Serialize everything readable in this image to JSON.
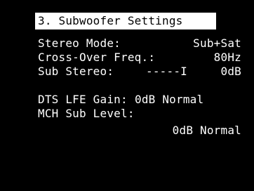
{
  "screen": {
    "title": "3. Subwoofer Settings",
    "rows": [
      {
        "label": "Stereo Mode:",
        "value": "Sub+Sat"
      },
      {
        "label": "Cross-Over Freq.:",
        "value": "80Hz"
      },
      {
        "label": "Sub Stereo:",
        "slider": "-----I",
        "value": "0dB"
      },
      {
        "label": "DTS LFE Gain:",
        "value": "0dB Normal"
      },
      {
        "label": "MCH Sub Level:"
      },
      {
        "value": "0dB Normal"
      }
    ]
  },
  "colors": {
    "background": "#000000",
    "text": "#ffffff",
    "title_bg": "#ffffff",
    "title_text": "#000000"
  }
}
